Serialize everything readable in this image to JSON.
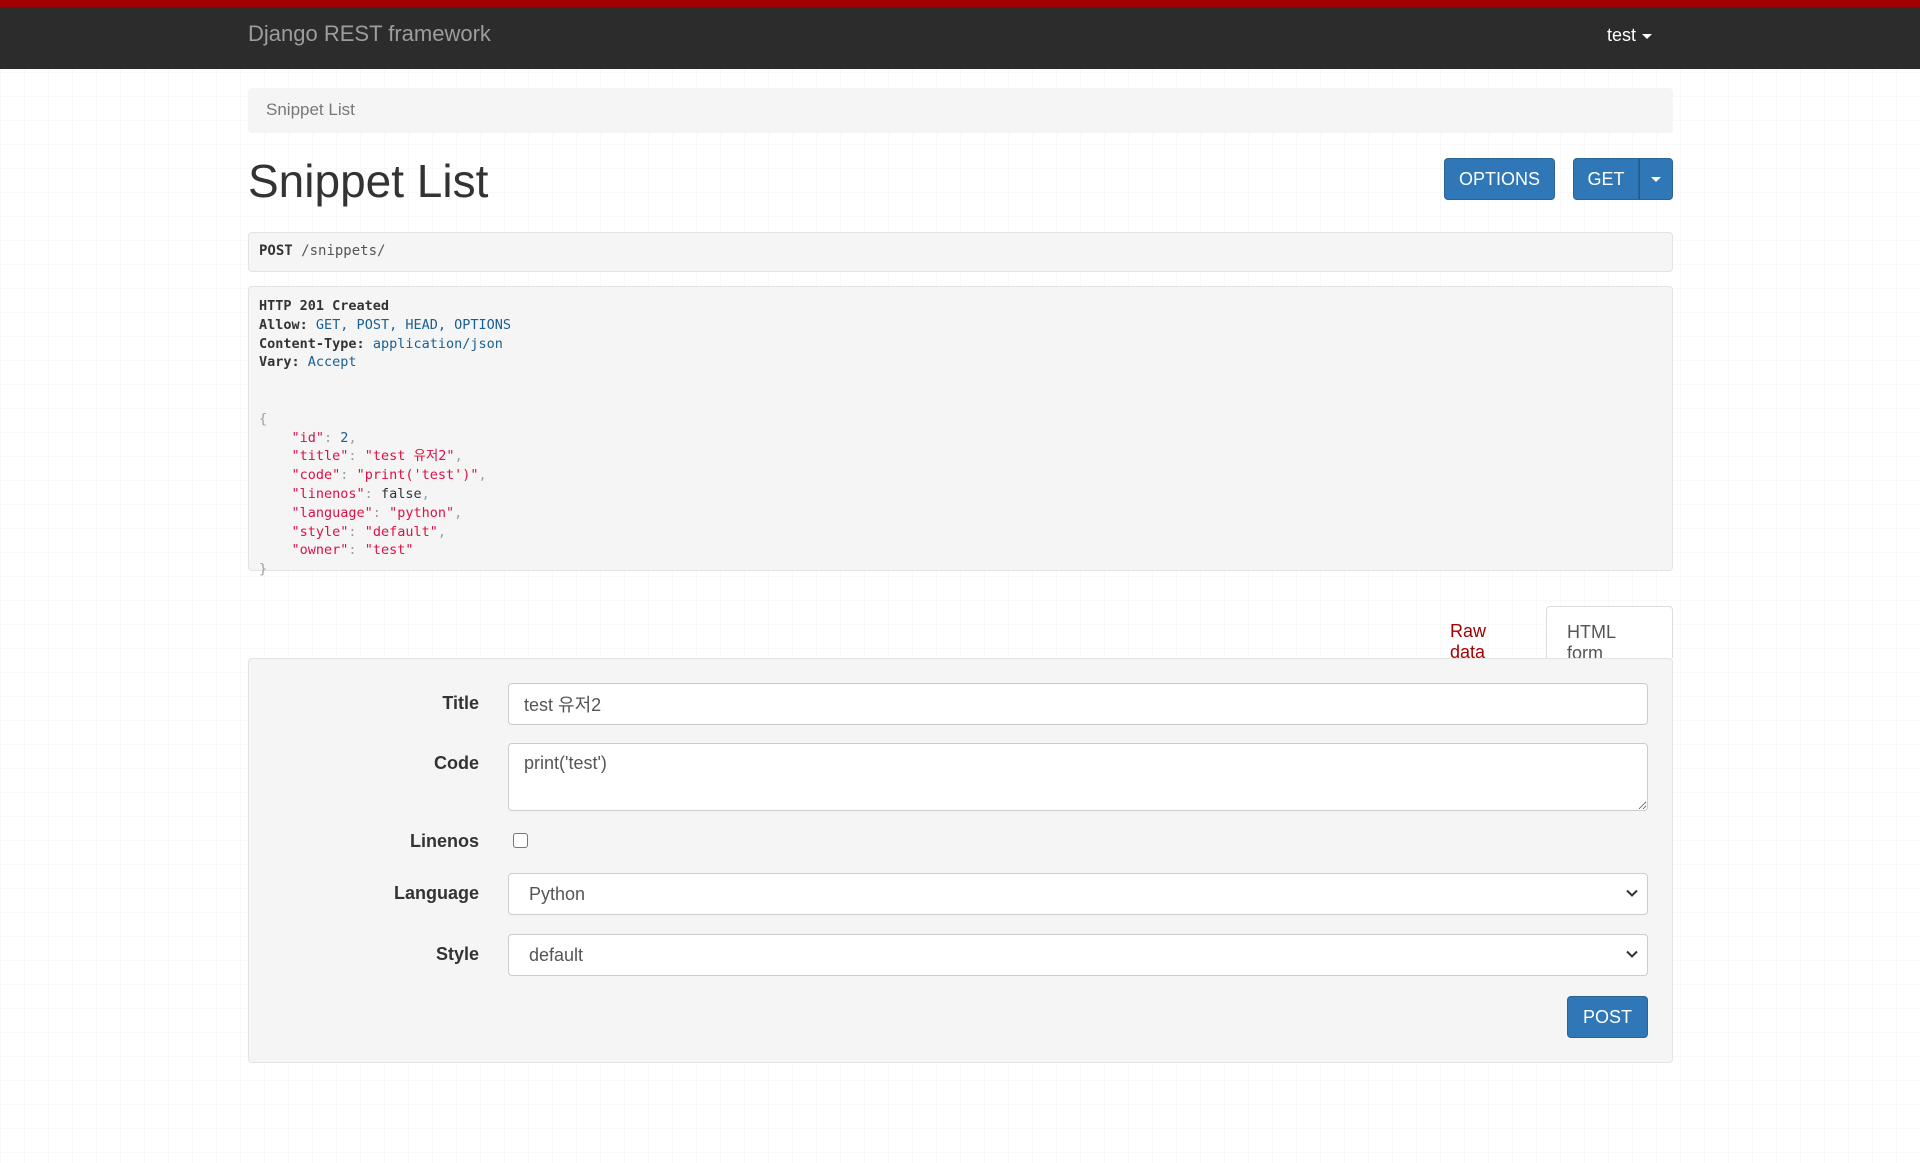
{
  "navbar": {
    "brand": "Django REST framework",
    "user": "test"
  },
  "breadcrumb": {
    "label": "Snippet List"
  },
  "page": {
    "title": "Snippet List"
  },
  "buttons": {
    "options": "OPTIONS",
    "get": "GET",
    "post": "POST"
  },
  "request": {
    "method": "POST",
    "path": "/snippets/"
  },
  "response": {
    "status": "HTTP 201 Created",
    "headers": [
      {
        "name": "Allow:",
        "value": "GET, POST, HEAD, OPTIONS"
      },
      {
        "name": "Content-Type:",
        "value": "application/json"
      },
      {
        "name": "Vary:",
        "value": "Accept"
      }
    ],
    "body": [
      {
        "key": "\"id\"",
        "value": "2",
        "kind": "num"
      },
      {
        "key": "\"title\"",
        "value": "\"test 유저2\"",
        "kind": "str"
      },
      {
        "key": "\"code\"",
        "value": "\"print('test')\"",
        "kind": "str"
      },
      {
        "key": "\"linenos\"",
        "value": "false",
        "kind": "lit"
      },
      {
        "key": "\"language\"",
        "value": "\"python\"",
        "kind": "str"
      },
      {
        "key": "\"style\"",
        "value": "\"default\"",
        "kind": "str"
      },
      {
        "key": "\"owner\"",
        "value": "\"test\"",
        "kind": "str"
      }
    ]
  },
  "tabs": {
    "raw": "Raw data",
    "html": "HTML form"
  },
  "form": {
    "title_label": "Title",
    "title_value": "test 유저2",
    "code_label": "Code",
    "code_value": "print('test')",
    "linenos_label": "Linenos",
    "linenos_checked": false,
    "language_label": "Language",
    "language_value": "Python",
    "style_label": "Style",
    "style_value": "default"
  },
  "colors": {
    "accent_bar": "#a30000",
    "navbar": "#2c2c2c",
    "primary_button": "#2f77b6",
    "link_red": "#a30000"
  }
}
